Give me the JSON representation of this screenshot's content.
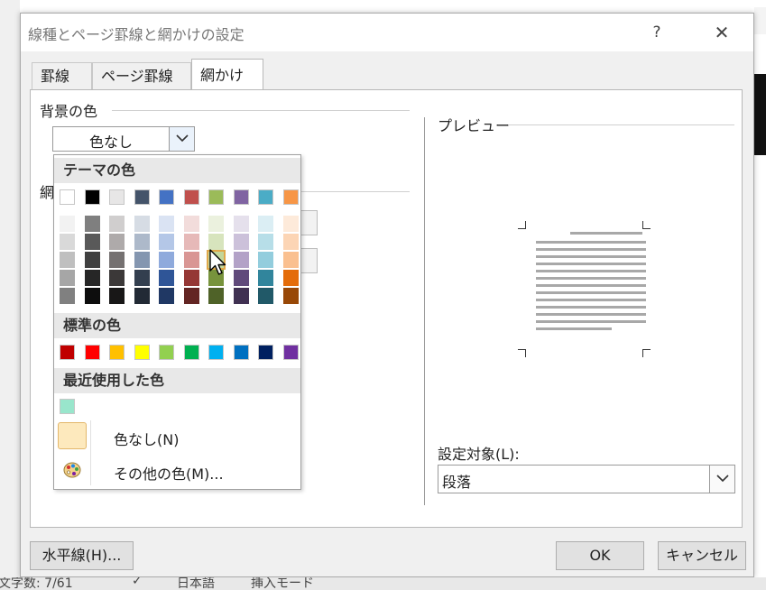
{
  "dialog": {
    "title": "線種とページ罫線と網かけの設定",
    "help": "?",
    "close": "✕"
  },
  "tabs": [
    {
      "label": "罫線",
      "active": false
    },
    {
      "label": "ページ罫線",
      "active": false
    },
    {
      "label": "網かけ",
      "active": true
    }
  ],
  "shading": {
    "background_label": "背景の色",
    "background_value": "色なし",
    "pattern_label_partial": "網"
  },
  "preview": {
    "label": "プレビュー"
  },
  "apply": {
    "label": "設定対象(L):",
    "value": "段落"
  },
  "buttons": {
    "horizontal_line": "水平線(H)...",
    "ok": "OK",
    "cancel": "キャンセル"
  },
  "color_menu": {
    "theme_heading": "テーマの色",
    "standard_heading": "標準の色",
    "recent_heading": "最近使用した色",
    "no_color": "色なし(N)",
    "more_colors": "その他の色(M)...",
    "theme_top": [
      "#ffffff",
      "#000000",
      "#e7e6e6",
      "#44546a",
      "#4472c4",
      "#c0504d",
      "#9bbb59",
      "#8064a2",
      "#4bacc6",
      "#f79646"
    ],
    "theme_shades": [
      [
        "#f2f2f2",
        "#d9d9d9",
        "#bfbfbf",
        "#a6a6a6",
        "#808080"
      ],
      [
        "#7f7f7f",
        "#595959",
        "#404040",
        "#262626",
        "#0d0d0d"
      ],
      [
        "#d0cece",
        "#aeaaaa",
        "#757171",
        "#3b3838",
        "#181717"
      ],
      [
        "#d6dce4",
        "#adb9ca",
        "#8496b0",
        "#333f4f",
        "#222a35"
      ],
      [
        "#dae3f3",
        "#b4c7e7",
        "#8faadc",
        "#2f5597",
        "#203864"
      ],
      [
        "#f2dcdb",
        "#e6b9b8",
        "#d99694",
        "#953735",
        "#632523"
      ],
      [
        "#ebf1de",
        "#d7e4bd",
        "#c3d69b",
        "#77933c",
        "#4f6228"
      ],
      [
        "#e5e0ec",
        "#ccc1da",
        "#b3a2c7",
        "#604a7b",
        "#403152"
      ],
      [
        "#dbeef4",
        "#b7dee8",
        "#93cddd",
        "#31859c",
        "#215968"
      ],
      [
        "#fdeada",
        "#fcd5b5",
        "#fac090",
        "#e46c0a",
        "#984807"
      ]
    ],
    "standard": [
      "#c00000",
      "#ff0000",
      "#ffc000",
      "#ffff00",
      "#92d050",
      "#00b050",
      "#00b0f0",
      "#0070c0",
      "#002060",
      "#7030a0"
    ],
    "recent": [
      "#99e6cc"
    ]
  },
  "status_bar": {
    "word_count": "文字数: 7/61",
    "language": "日本語",
    "mode": "挿入モード"
  }
}
